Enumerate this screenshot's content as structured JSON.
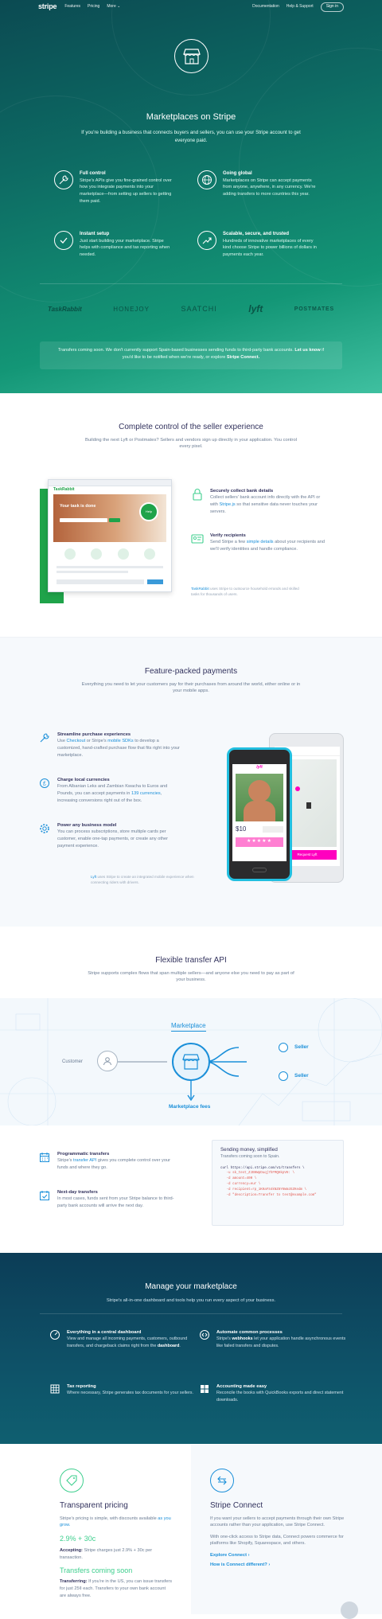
{
  "nav": {
    "logo": "stripe",
    "links": [
      "Features",
      "Pricing",
      "More ⌄"
    ],
    "right_links": [
      "Documentation",
      "Help & Support"
    ],
    "signin": "Sign in"
  },
  "hero": {
    "title": "Marketplaces on Stripe",
    "lead": "If you're building a business that connects buyers and sellers, you can use your Stripe account to get everyone paid.",
    "features": [
      {
        "icon": "wrench-icon",
        "title": "Full control",
        "desc": "Stripe's APIs give you fine-grained control over how you integrate payments into your marketplace—from setting up sellers to getting them paid."
      },
      {
        "icon": "globe-icon",
        "title": "Going global",
        "desc": "Marketplaces on Stripe can accept payments from anyone, anywhere, in any currency. We're adding transfers to more countries this year."
      },
      {
        "icon": "checkmark-icon",
        "title": "Instant setup",
        "desc": "Just start building your marketplace. Stripe helps with compliance and tax reporting when needed."
      },
      {
        "icon": "trend-icon",
        "title": "Scalable, secure, and trusted",
        "desc": "Hundreds of innovative marketplaces of every kind choose Stripe to power billions of dollars in payments each year."
      }
    ],
    "logos": [
      "TaskRabbit",
      "HONEJOY",
      "SAATCHI",
      "lyft",
      "POSTMATES"
    ],
    "notice_text": "Transfers coming soon. We don't currently support Spain-based businesses sending funds to third-party bank accounts.",
    "notice_link1": "Let us know",
    "notice_mid": "if you'd like to be notified when we're ready, or explore",
    "notice_link2": "Stripe Connect."
  },
  "control": {
    "title": "Complete control of the seller experience",
    "sub": "Building the next Lyft or Postmates? Sellers and vendors sign up directly in your application. You control every pixel.",
    "items": [
      {
        "title": "Securely collect bank details",
        "desc_a": "Collect sellers' bank account info directly with the API or with",
        "link": "Stripe.js",
        "desc_b": "so that sensitive data never touches your servers."
      },
      {
        "title": "Verify recipients",
        "desc_a": "Send Stripe a few",
        "link": "simple details",
        "desc_b": "about your recipients and we'll verify identities and handle compliance."
      }
    ],
    "caption_brand": "TaskRabbit",
    "caption": "uses Stripe to outsource household errands and skilled tasks for thousands of users.",
    "mock": {
      "brand": "TaskRabbit",
      "hero_text": "Your task is done",
      "badge": "Help"
    }
  },
  "payments": {
    "title": "Feature-packed payments",
    "sub": "Everything you need to let your customers pay for their purchases from around the world, either online or in your mobile apps.",
    "items": [
      {
        "title": "Streamline purchase experiences",
        "desc_a": "Use",
        "link1": "Checkout",
        "desc_m": "or Stripe's",
        "link2": "mobile SDKs",
        "desc_b": "to develop a customized, hand-crafted purchase flow that fits right into your marketplace."
      },
      {
        "title": "Charge local currencies",
        "desc_a": "From Albanian Leks and Zambian Kwacha to Euros and Pounds, you can accept payments in",
        "link1": "139 currencies",
        "desc_b": ", increasing conversions right out of the box."
      },
      {
        "title": "Power any business model",
        "desc_a": "You can process subscriptions, store multiple cards per customer, enable one-tap payments, or create any other payment experience."
      }
    ],
    "caption_brand": "Lyft",
    "caption": "uses Stripe to create an integrated mobile experience when connecting riders with drivers.",
    "phone": {
      "app": "lyft",
      "amount": "$10",
      "button": "Request Lyft"
    }
  },
  "transfer": {
    "title": "Flexible transfer API",
    "sub": "Stripe supports complex flows that span multiple sellers—and anyone else you need to pay as part of your business.",
    "diagram": {
      "marketplace": "Marketplace",
      "customer": "Customer",
      "seller": "Seller",
      "fees": "Marketplace fees"
    },
    "items": [
      {
        "title": "Programmatic transfers",
        "desc_a": "Stripe's",
        "link": "transfer API",
        "desc_b": "gives you complete control over your funds and where they go."
      },
      {
        "title": "Next-day transfers",
        "desc_a": "In most cases, funds sent from your Stripe balance to third-party bank accounts will arrive the next day."
      }
    ],
    "code": {
      "title": "Sending money, simplified",
      "sub": "Transfers coming soon to Spain.",
      "lines": [
        "curl https://api.stripe.com/v1/transfers \\",
        "   -u sk_test_ZJBHWpDuqj7hFMQHkpVH: \\",
        "   -d amount=400 \\",
        "   -d currency=eur \\",
        "   -d recipient=rp_1K9aFS4kNZ8Y6WmzEZKedm \\",
        "   -d \"description=Transfer to test@example.com\""
      ]
    }
  },
  "manage": {
    "title": "Manage your marketplace",
    "sub": "Stripe's all-in-one dashboard and tools help you run every aspect of your business.",
    "items": [
      {
        "title": "Everything in a central dashboard",
        "desc_a": "View and manage all incoming payments, customers, outbound transfers, and chargeback claims right from the",
        "bold": "dashboard",
        "desc_b": "."
      },
      {
        "title": "Automate common processes",
        "desc_a": "Stripe's",
        "bold": "webhooks",
        "desc_b": "let your application handle asynchronous events like failed transfers and disputes."
      },
      {
        "title": "Tax reporting",
        "desc_a": "Where necessary, Stripe generates tax documents for your sellers."
      },
      {
        "title": "Accounting made easy",
        "desc_a": "Reconcile the books with QuickBooks exports and direct statement downloads."
      }
    ]
  },
  "pricing": {
    "title": "Transparent pricing",
    "desc": "Stripe's pricing is simple, with discounts available",
    "link": "as you grow.",
    "price": "2.9% + 30c",
    "accept_b": "Accepting:",
    "accept": "Stripe charges just 2.9% + 30c per transaction.",
    "soon": "Transfers coming soon",
    "transfer_b": "Transferring:",
    "transfer": "If you're in the US, you can issue transfers for just 25¢ each. Transfers to your own bank account are always free."
  },
  "connect": {
    "title": "Stripe Connect",
    "desc1": "If you want your sellers to accept payments through their own Stripe accounts rather than your application, use Stripe Connect.",
    "desc2": "With one-click access to Stripe data, Connect powers commerce for platforms like Shopify, Squarespace, and others.",
    "link1": "Explore Connect ›",
    "link2": "How is Connect different? ›"
  },
  "colors": {
    "teal": "#139676",
    "dark_teal": "#0b4a52",
    "link": "#1a8fd9",
    "green": "#3ecf8e",
    "navy": "#0c3d57"
  }
}
